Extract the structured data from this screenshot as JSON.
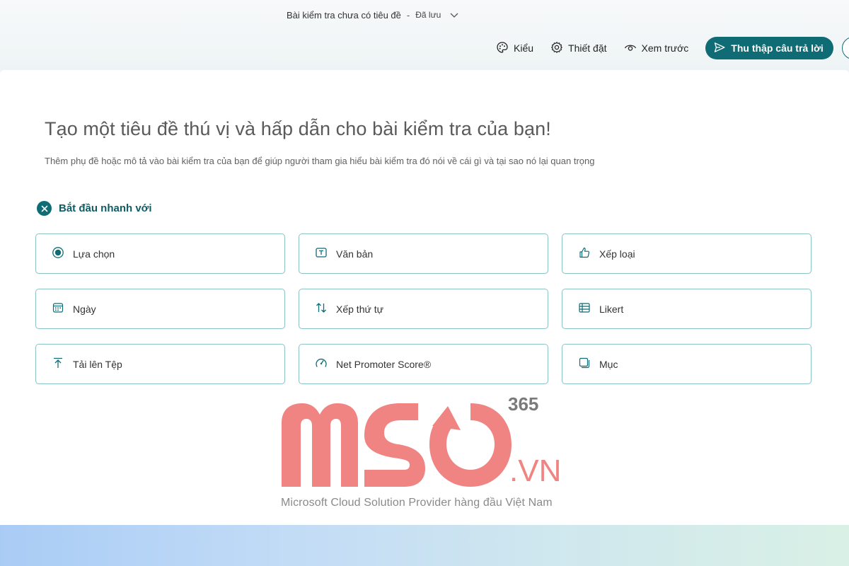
{
  "header": {
    "doc_title": "Bài kiểm tra chưa có tiêu đề",
    "separator": "-",
    "save_status": "Đã lưu",
    "actions": {
      "style_label": "Kiểu",
      "settings_label": "Thiết đặt",
      "preview_label": "Xem trước",
      "collect_label": "Thu thập câu trả lời"
    }
  },
  "main": {
    "heading": "Tạo một tiêu đề thú vị và hấp dẫn cho bài kiểm tra của bạn!",
    "subtitle": "Thêm phụ đề hoặc mô tả vào bài kiểm tra của bạn để giúp người tham gia hiểu bài kiểm tra đó nói về cái gì và tại sao nó lại quan trọng",
    "quick_start_label": "Bắt đầu nhanh với",
    "question_types": [
      {
        "label": "Lựa chọn",
        "icon": "radio-icon"
      },
      {
        "label": "Văn bản",
        "icon": "text-box-icon"
      },
      {
        "label": "Xếp loại",
        "icon": "thumbs-up-icon"
      },
      {
        "label": "Ngày",
        "icon": "calendar-icon"
      },
      {
        "label": "Xếp thứ tự",
        "icon": "sort-arrows-icon"
      },
      {
        "label": "Likert",
        "icon": "table-icon"
      },
      {
        "label": "Tải lên Tệp",
        "icon": "upload-icon"
      },
      {
        "label": "Net Promoter Score®",
        "icon": "gauge-icon"
      },
      {
        "label": "Mục",
        "icon": "section-icon"
      }
    ]
  },
  "watermark": {
    "brand": "MSO",
    "brand_superscript": "365",
    "brand_suffix": ".VN",
    "caption": "Microsoft Cloud Solution Provider hàng đầu Việt Nam"
  },
  "colors": {
    "accent": "#0f6b74",
    "tile_border": "#8cc3c5",
    "watermark": "#ef8482"
  }
}
